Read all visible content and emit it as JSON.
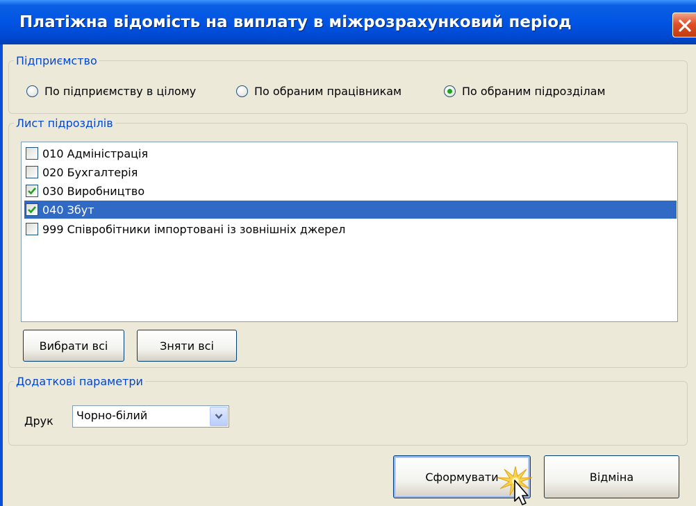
{
  "window": {
    "title": "Платіжна відомість на виплату в міжрозрахунковий період"
  },
  "enterprise_group": {
    "legend": "Підприємство",
    "options": [
      {
        "label": "По підприємству в цілому",
        "selected": false
      },
      {
        "label": "По обраним працівникам",
        "selected": false
      },
      {
        "label": "По обраним підрозділам",
        "selected": true
      }
    ]
  },
  "departments_group": {
    "legend": "Лист підрозділів",
    "items": [
      {
        "label": "010 Адміністрація",
        "checked": false,
        "selected": false
      },
      {
        "label": "020 Бухгалтерія",
        "checked": false,
        "selected": false
      },
      {
        "label": "030 Виробництво",
        "checked": true,
        "selected": false
      },
      {
        "label": "040 Збут",
        "checked": true,
        "selected": true
      },
      {
        "label": "999 Співробітники імпортовані із зовнішніх джерел",
        "checked": false,
        "selected": false
      }
    ],
    "select_all_label": "Вибрати всі",
    "deselect_all_label": "Зняти всі"
  },
  "extra_group": {
    "legend": "Додаткові параметри",
    "print_label": "Друк",
    "print_value": "Чорно-білий"
  },
  "footer": {
    "generate_label": "Сформувати",
    "cancel_label": "Відміна"
  },
  "colors": {
    "title_bar": "#0054e3",
    "selection": "#316ac5",
    "group_legend": "#0046d5",
    "dialog_bg": "#ece9d8"
  }
}
